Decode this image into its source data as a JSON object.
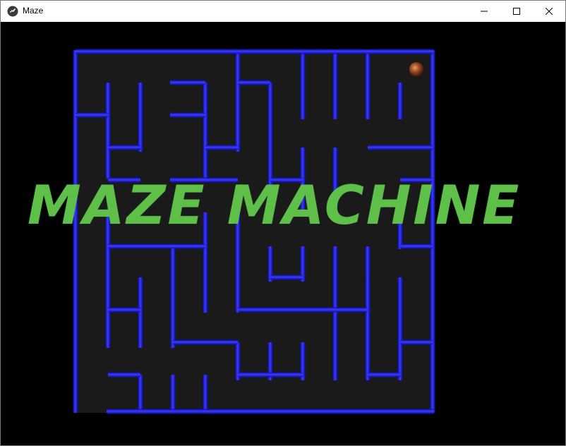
{
  "window": {
    "title": "Maze",
    "icon": "kivy-app-icon",
    "controls": [
      "minimize-icon",
      "maximize-icon",
      "close-icon"
    ]
  },
  "game": {
    "banner_text": "MAZE MACHINE",
    "colors": {
      "background": "#000000",
      "maze_floor": "#1a1a1a",
      "wall": "#1f1fd9",
      "wall_highlight": "#4a4aff",
      "banner": "#5ec049",
      "ball": "#8a3a1e"
    },
    "player": "ball-sprite"
  }
}
